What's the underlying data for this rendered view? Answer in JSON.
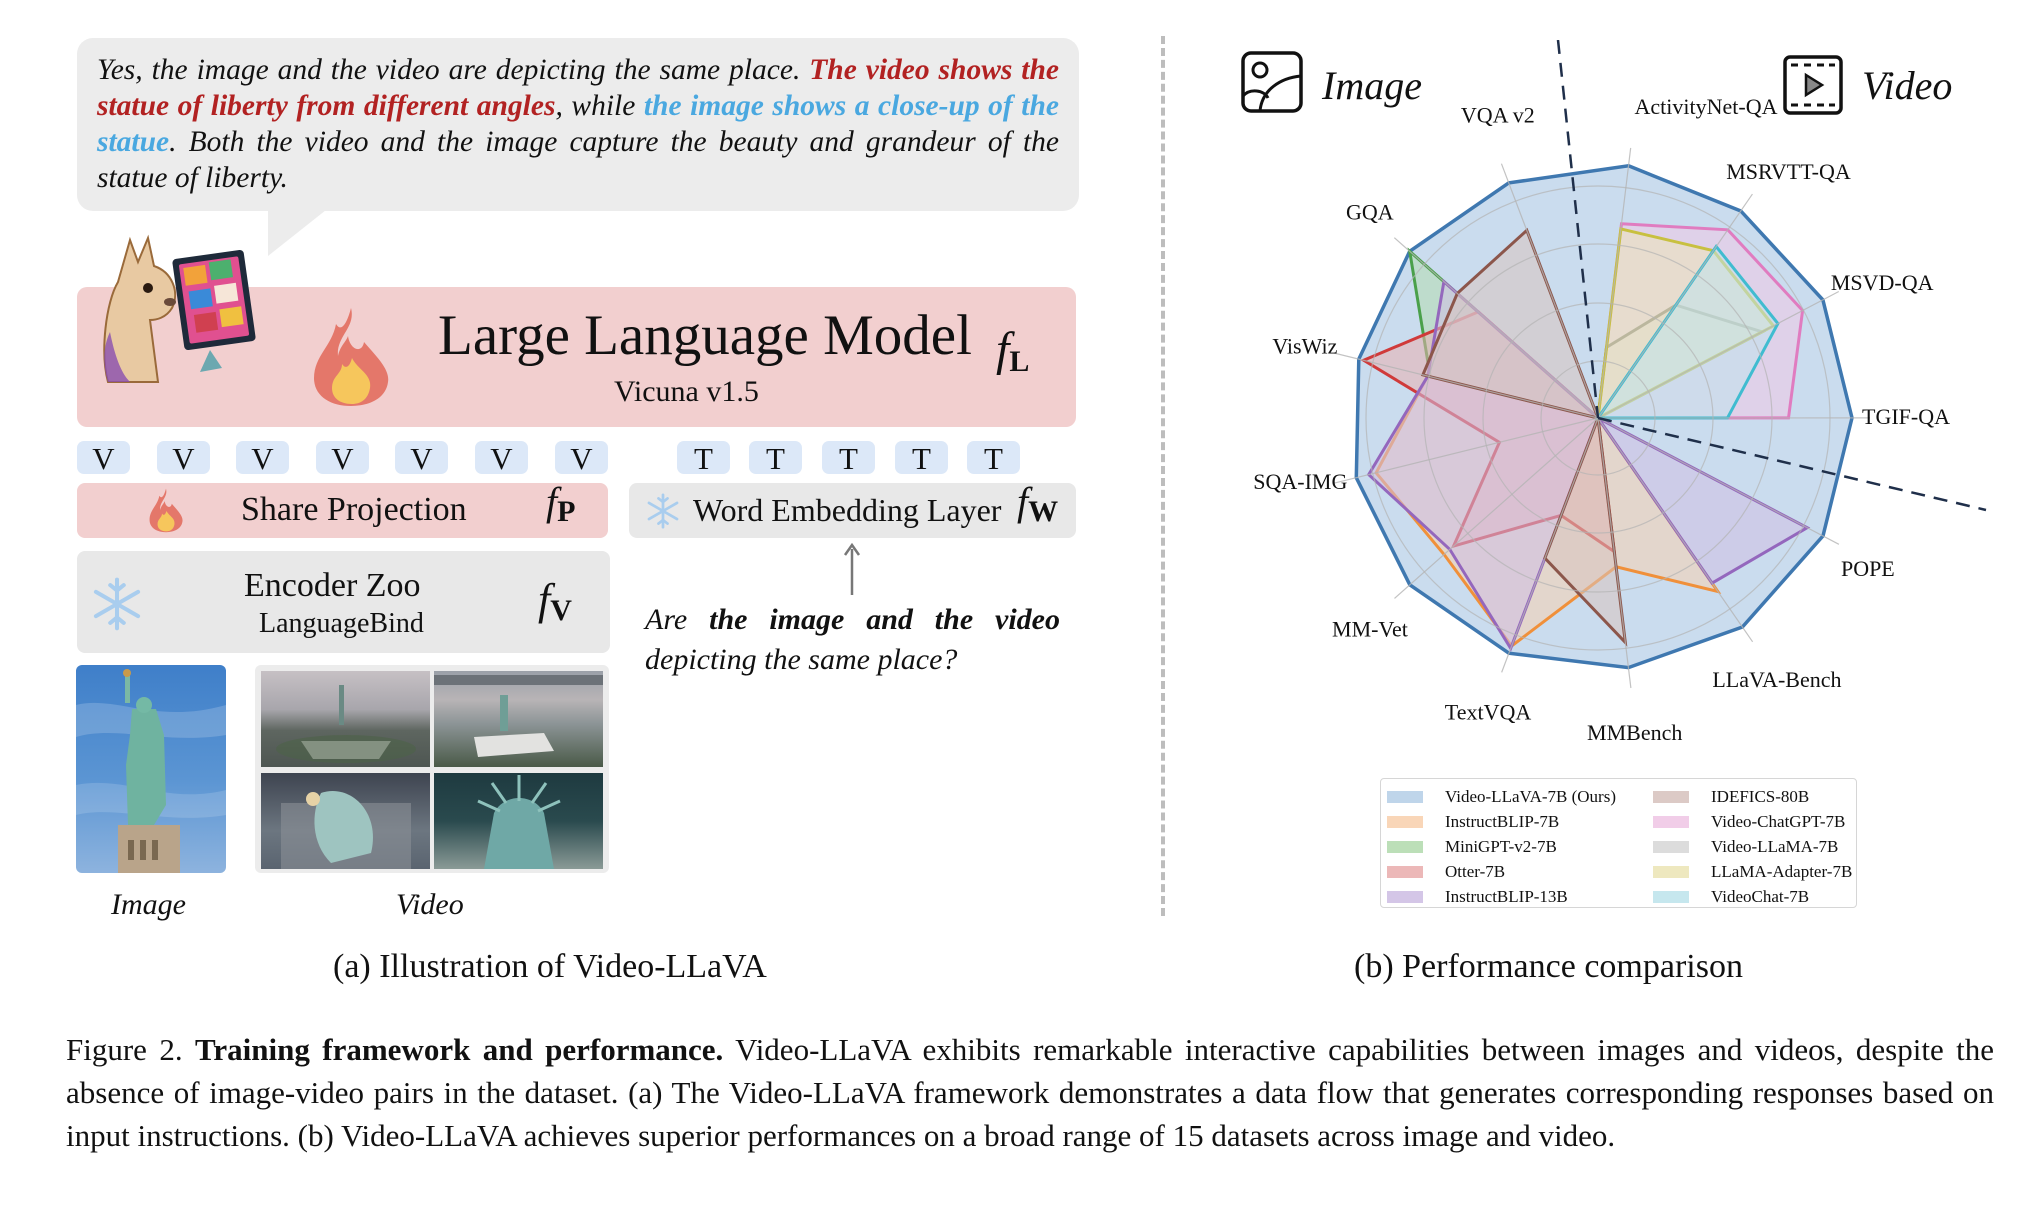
{
  "left_panel": {
    "response": {
      "part1": "Yes, the image and the video are depicting the same place. ",
      "part2_red": "The video shows the statue of liberty from different angles",
      "part3": ", while ",
      "part4_blue": "the image shows a close-up of the statue",
      "part5": ". Both the video and the image capture the beauty and grandeur of the statue of liberty."
    },
    "llm": {
      "title": "Large Language Model",
      "subtitle": "Vicuna v1.5",
      "symbol": "f",
      "symbol_sub": "L"
    },
    "visual_tokens": [
      "V",
      "V",
      "V",
      "V",
      "V",
      "V",
      "V"
    ],
    "text_tokens": [
      "T",
      "T",
      "T",
      "T",
      "T"
    ],
    "share_projection": {
      "label": "Share Projection",
      "symbol": "f",
      "symbol_sub": "P"
    },
    "word_embedding": {
      "label": "Word Embedding Layer",
      "symbol": "f",
      "symbol_sub": "W"
    },
    "encoder": {
      "title": "Encoder Zoo",
      "subtitle": "LanguageBind",
      "symbol": "f",
      "symbol_sub": "V"
    },
    "question": {
      "pre": "Are ",
      "bold": "the image and the video",
      "post": " depicting the same place?"
    },
    "image_label": "Image",
    "video_label": "Video",
    "subcaption": "(a) Illustration of Video-LLaVA",
    "icons": {
      "trainable": "fire-icon",
      "frozen": "snowflake-icon",
      "mascot": "alpaca-monitor-illustration"
    }
  },
  "right_panel": {
    "image_header": "Image",
    "video_header": "Video",
    "subcaption": "(b) Performance comparison"
  },
  "caption": {
    "prefix": "Figure 2. ",
    "bold": "Training framework and performance.",
    "text": " Video-LLaVA exhibits remarkable interactive capabilities between images and videos, despite the absence of image-video pairs in the dataset. (a) The Video-LLaVA framework demonstrates a data flow that generates corresponding responses based on input instructions. (b) Video-LLaVA achieves superior performances on a broad range of 15 datasets across image and video."
  },
  "chart_data": {
    "type": "radar",
    "title": "Performance comparison",
    "value_scale": "normalized per axis (0 = center, 1 = outer ring)",
    "axes": [
      "ActivityNet-QA",
      "MSRVTT-QA",
      "MSVD-QA",
      "TGIF-QA",
      "POPE",
      "LLaVA-Bench",
      "MMBench",
      "TextVQA",
      "MM-Vet",
      "SQA-IMG",
      "VisWiz",
      "GQA",
      "VQA v2"
    ],
    "axis_groups": {
      "Video": [
        "ActivityNet-QA",
        "MSRVTT-QA",
        "MSVD-QA",
        "TGIF-QA"
      ],
      "Image": [
        "POPE",
        "LLaVA-Bench",
        "MMBench",
        "TextVQA",
        "MM-Vet",
        "SQA-IMG",
        "VisWiz",
        "GQA",
        "VQA v2"
      ]
    },
    "rings": 4,
    "grid": true,
    "legend_position": "bottom",
    "series": [
      {
        "name": "Video-LLaVA-7B (Ours)",
        "color": "#3f78b0",
        "fill": "#b8d0e8",
        "values": [
          1.0,
          0.99,
          1.0,
          1.0,
          1.0,
          1.0,
          0.99,
          0.99,
          0.99,
          0.98,
          0.97,
          0.99,
          0.99
        ]
      },
      {
        "name": "InstructBLIP-7B",
        "color": "#f0903a",
        "fill": "#f8d2b0",
        "values": [
          0,
          0,
          0,
          0,
          0,
          0.83,
          0.59,
          0.96,
          0.81,
          0.9,
          0.69,
          0,
          0
        ]
      },
      {
        "name": "MiniGPT-v2-7B",
        "color": "#4aa04a",
        "fill": "#b5dcb0",
        "values": [
          0,
          0,
          0,
          0,
          0,
          0,
          0,
          0,
          0,
          0,
          0.68,
          0.99,
          0
        ]
      },
      {
        "name": "Otter-7B",
        "color": "#d03a3a",
        "fill": "#eab0b0",
        "values": [
          0,
          0,
          0,
          0,
          0,
          0,
          0.53,
          0.41,
          0.76,
          0.4,
          0.95,
          0.63,
          0
        ]
      },
      {
        "name": "InstructBLIP-13B",
        "color": "#9467bd",
        "fill": "#cfc0e4",
        "values": [
          0,
          0,
          0,
          0,
          0.93,
          0.79,
          0,
          0.97,
          0.78,
          0.93,
          0.69,
          0.81,
          0
        ]
      },
      {
        "name": "IDEFICS-80B",
        "color": "#8c564b",
        "fill": "#d8c4c0",
        "values": [
          0,
          0,
          0,
          0,
          0,
          0,
          0.89,
          0.59,
          0,
          0,
          0.71,
          0.74,
          0.79
        ]
      },
      {
        "name": "Video-ChatGPT-7B",
        "color": "#e07cc0",
        "fill": "#f0c8e6",
        "values": [
          0.77,
          0.9,
          0.91,
          0.75,
          0,
          0,
          0,
          0,
          0,
          0,
          0,
          0,
          0
        ]
      },
      {
        "name": "Video-LLaMA-7B",
        "color": "#7f7f7f",
        "fill": "#d8d8d8",
        "values": [
          0.28,
          0.54,
          0.73,
          0,
          0,
          0,
          0,
          0,
          0,
          0,
          0,
          0,
          0
        ]
      },
      {
        "name": "LLaMA-Adapter-7B",
        "color": "#c8c040",
        "fill": "#ece6b8",
        "values": [
          0.75,
          0.8,
          0.78,
          0,
          0,
          0,
          0,
          0,
          0,
          0,
          0,
          0,
          0
        ]
      },
      {
        "name": "VideoChat-7B",
        "color": "#40bcd0",
        "fill": "#c0e4ec",
        "values": [
          0,
          0.82,
          0.8,
          0.51,
          0,
          0,
          0,
          0,
          0,
          0,
          0,
          0,
          0
        ]
      }
    ]
  }
}
